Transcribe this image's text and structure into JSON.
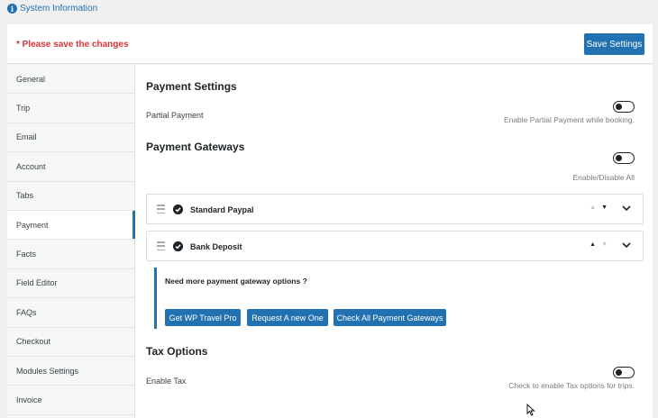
{
  "top_link": {
    "icon": "info-icon",
    "label": "System Information"
  },
  "save_bar": {
    "notice": "* Please save the changes",
    "save_label": "Save Settings"
  },
  "sidebar": {
    "items": [
      {
        "label": "General"
      },
      {
        "label": "Trip"
      },
      {
        "label": "Email"
      },
      {
        "label": "Account"
      },
      {
        "label": "Tabs"
      },
      {
        "label": "Payment",
        "active": true
      },
      {
        "label": "Facts"
      },
      {
        "label": "Field Editor"
      },
      {
        "label": "FAQs"
      },
      {
        "label": "Checkout"
      },
      {
        "label": "Modules Settings"
      },
      {
        "label": "Invoice"
      }
    ]
  },
  "payment_settings": {
    "title": "Payment Settings",
    "partial_label": "Partial Payment",
    "partial_desc": "Enable Partial Payment while booking.",
    "partial_enabled": false
  },
  "payment_gateways": {
    "title": "Payment Gateways",
    "toggle_desc": "Enable/Disable All",
    "all_enabled": false,
    "items": [
      {
        "name": "Standard Paypal",
        "checked": true
      },
      {
        "name": "Bank Deposit",
        "checked": true
      }
    ],
    "promo_text": "Need more payment gateway options ?",
    "buttons": [
      "Get WP Travel Pro",
      "Request A new One",
      "Check All Payment Gateways"
    ]
  },
  "tax_options": {
    "title": "Tax Options",
    "label": "Enable Tax",
    "desc": "Check to enable Tax options for trips.",
    "enabled": false
  },
  "colors": {
    "accent": "#2271b1",
    "notice": "#d63638"
  }
}
